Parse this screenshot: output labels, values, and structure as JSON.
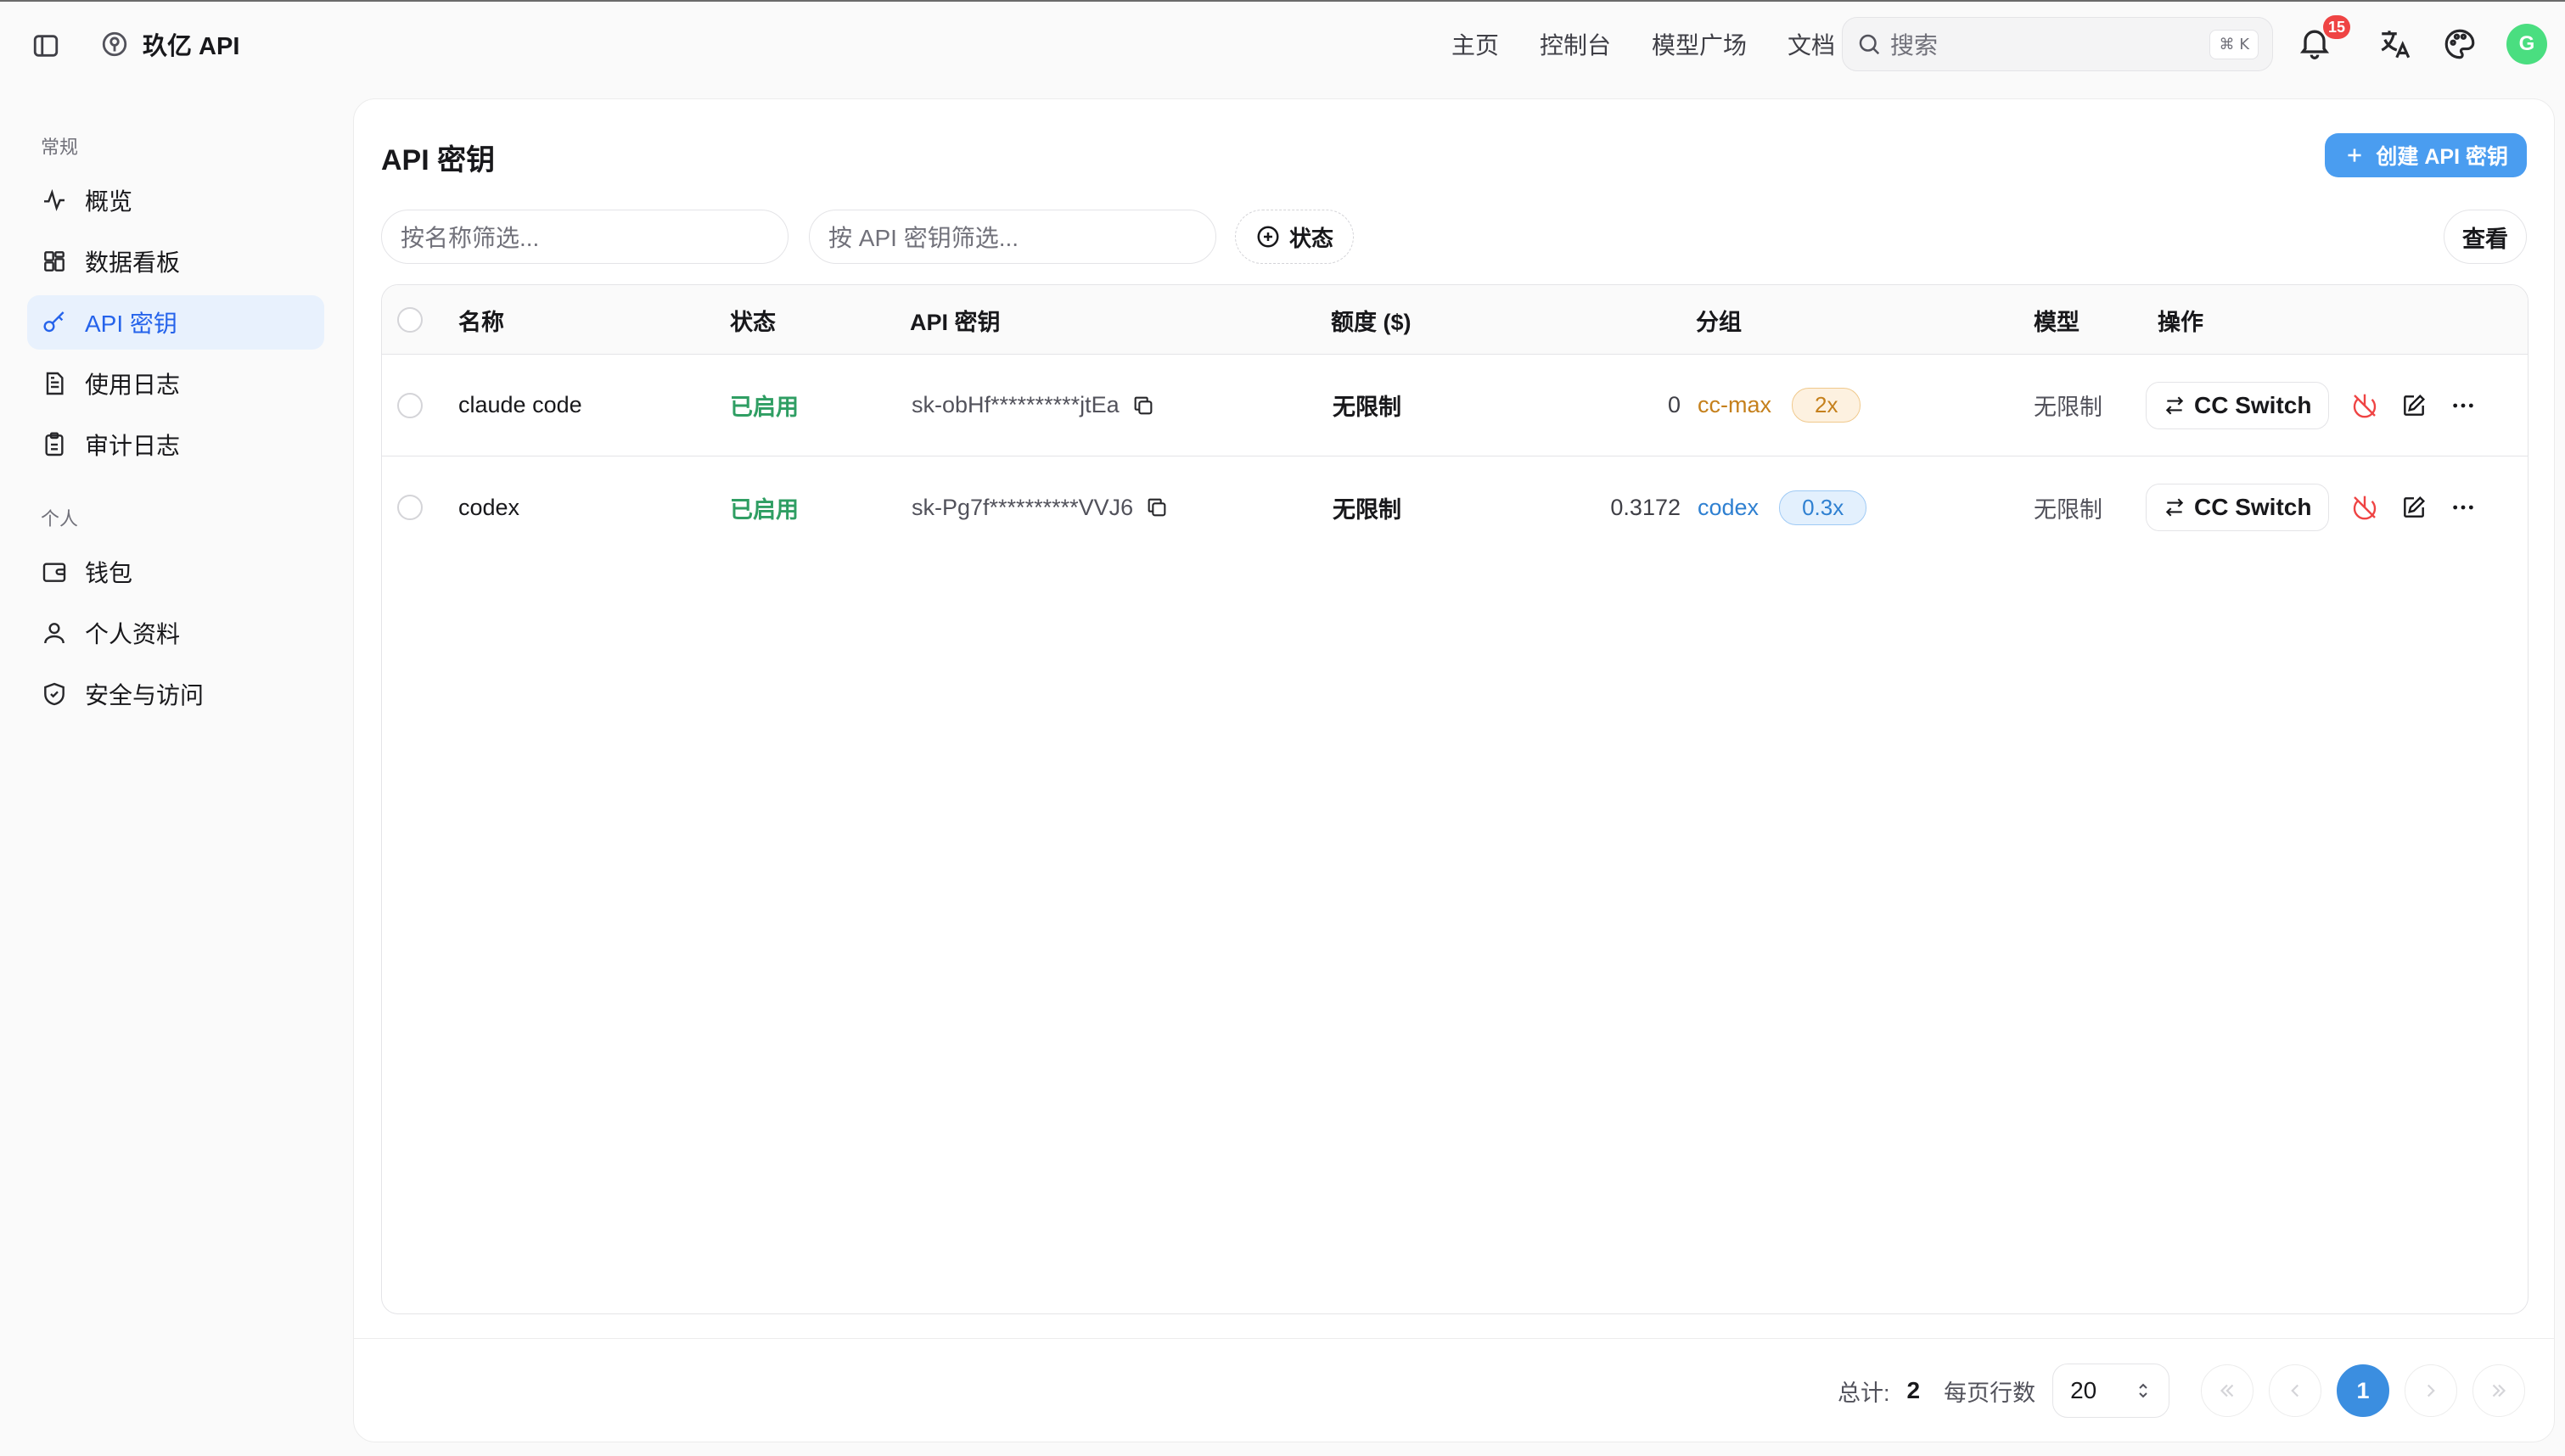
{
  "app": {
    "brand": "玖亿 API"
  },
  "nav": {
    "items": [
      "主页",
      "控制台",
      "模型广场",
      "文档"
    ]
  },
  "search": {
    "placeholder": "搜索",
    "shortcut": "⌘ K"
  },
  "notifications": {
    "count": "15"
  },
  "user": {
    "initial": "G"
  },
  "colors": {
    "accent": "#4a9df0",
    "active_bg": "#e8f1fd",
    "success": "#2f9e63",
    "badge": "#ef4444"
  },
  "sidebar": {
    "sections": [
      {
        "title": "常规",
        "items": [
          {
            "label": "概览",
            "icon": "activity-icon"
          },
          {
            "label": "数据看板",
            "icon": "dashboard-grid-icon"
          },
          {
            "label": "API 密钥",
            "icon": "key-icon",
            "active": true
          },
          {
            "label": "使用日志",
            "icon": "file-text-icon"
          },
          {
            "label": "审计日志",
            "icon": "clipboard-icon"
          }
        ]
      },
      {
        "title": "个人",
        "items": [
          {
            "label": "钱包",
            "icon": "wallet-icon"
          },
          {
            "label": "个人资料",
            "icon": "user-icon"
          },
          {
            "label": "安全与访问",
            "icon": "shield-icon"
          }
        ]
      }
    ]
  },
  "page": {
    "title": "API 密钥",
    "create_label": "创建 API 密钥",
    "filter_name_placeholder": "按名称筛选...",
    "filter_key_placeholder": "按 API 密钥筛选...",
    "status_filter_label": "状态",
    "view_label": "查看"
  },
  "table": {
    "headers": {
      "name": "名称",
      "status": "状态",
      "key": "API 密钥",
      "quota": "额度 ($)",
      "group": "分组",
      "model": "模型",
      "actions": "操作"
    },
    "rows": [
      {
        "name": "claude code",
        "status": "已启用",
        "key": "sk-obHf**********jtEa",
        "quota": "无限制",
        "used": "0",
        "group": "cc-max",
        "ratio": "2x",
        "group_color": "orange",
        "model": "无限制",
        "action": "CC Switch"
      },
      {
        "name": "codex",
        "status": "已启用",
        "key": "sk-Pg7f**********VVJ6",
        "quota": "无限制",
        "used": "0.3172",
        "group": "codex",
        "ratio": "0.3x",
        "group_color": "blue",
        "model": "无限制",
        "action": "CC Switch"
      }
    ]
  },
  "pagination": {
    "total_label": "总计:",
    "total": "2",
    "per_page_label": "每页行数",
    "per_page": "20",
    "current_page": "1"
  }
}
